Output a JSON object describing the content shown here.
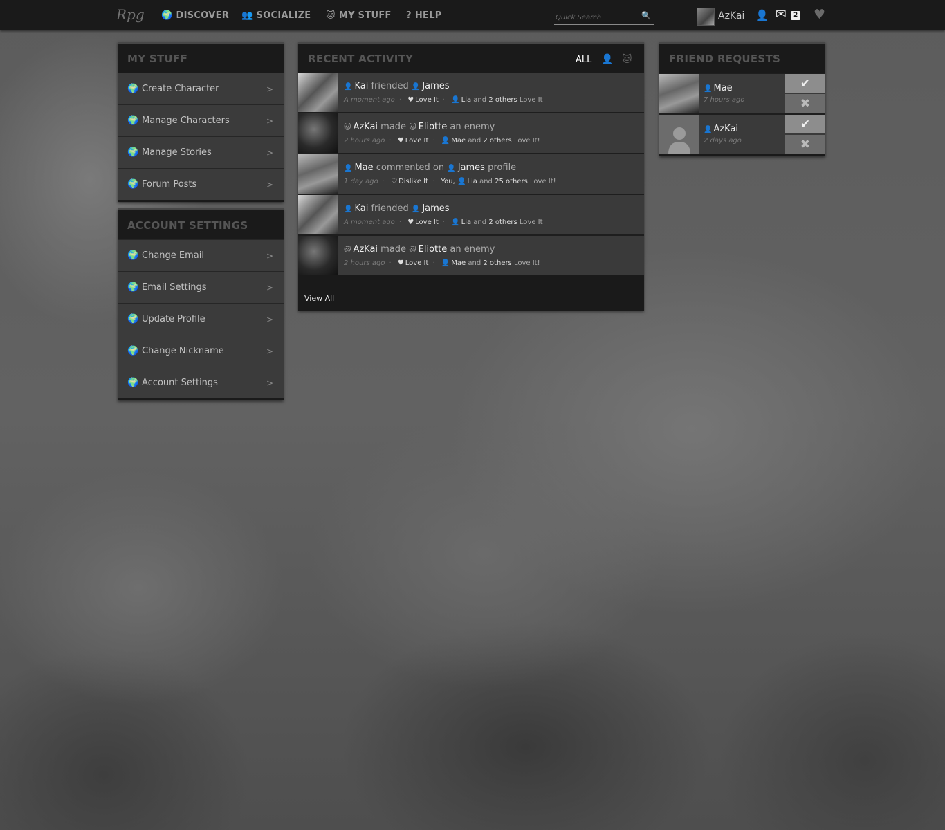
{
  "header": {
    "logo": "Rpg",
    "nav": [
      {
        "label": "DISCOVER",
        "icon": "🌍"
      },
      {
        "label": "SOCIALIZE",
        "icon": "👥"
      },
      {
        "label": "MY STUFF",
        "icon": "🐱"
      },
      {
        "label": "HELP",
        "icon": "?"
      }
    ],
    "search_placeholder": "Quick Search",
    "search_icon": "🔍",
    "username": "AzKai",
    "mail_count": "2",
    "icons": {
      "profile": "👤",
      "mail": "✉",
      "favorites": "♥"
    }
  },
  "my_stuff": {
    "title": "MY STUFF",
    "icon": "🌍",
    "arrow": ">",
    "items": [
      {
        "label": "Create Character"
      },
      {
        "label": "Manage Characters"
      },
      {
        "label": "Manage Stories"
      },
      {
        "label": "Forum Posts"
      }
    ]
  },
  "account_settings": {
    "title": "ACCOUNT SETTINGS",
    "icon": "🌍",
    "arrow": ">",
    "items": [
      {
        "label": "Change Email"
      },
      {
        "label": "Email Settings"
      },
      {
        "label": "Update Profile"
      },
      {
        "label": "Change Nickname"
      },
      {
        "label": "Account Settings"
      }
    ]
  },
  "activity": {
    "title": "RECENT ACTIVITY",
    "filters": {
      "all": "ALL",
      "person_icon": "👤",
      "character_icon": "🐱"
    },
    "view_all": "View All",
    "items": [
      {
        "actor": "Kai",
        "actor_icon": "👤",
        "verb": "friended",
        "target": "James",
        "target_icon": "👤",
        "suffix": "",
        "time": "A moment ago",
        "reaction": "Love It",
        "reaction_icon": "♥",
        "prefix_you": "",
        "liker": "Lia",
        "and_text": "and",
        "others": "2 others",
        "tail": "Love It!"
      },
      {
        "actor": "AzKai",
        "actor_icon": "🐱",
        "verb": "made",
        "target": "Eliotte",
        "target_icon": "🐱",
        "suffix": "an enemy",
        "time": "2 hours ago",
        "reaction": "Love It",
        "reaction_icon": "♥",
        "prefix_you": "",
        "liker": "Mae",
        "and_text": "and",
        "others": "2 others",
        "tail": "Love It!"
      },
      {
        "actor": "Mae",
        "actor_icon": "👤",
        "verb": "commented on",
        "target": "James",
        "target_icon": "👤",
        "suffix": "profile",
        "time": "1 day ago",
        "reaction": "Dislike It",
        "reaction_icon": "♡",
        "prefix_you": "You,",
        "liker": "Lia",
        "and_text": "and",
        "others": "25 others",
        "tail": "Love It!"
      },
      {
        "actor": "Kai",
        "actor_icon": "👤",
        "verb": "friended",
        "target": "James",
        "target_icon": "👤",
        "suffix": "",
        "time": "A moment ago",
        "reaction": "Love It",
        "reaction_icon": "♥",
        "prefix_you": "",
        "liker": "Lia",
        "and_text": "and",
        "others": "2 others",
        "tail": "Love It!"
      },
      {
        "actor": "AzKai",
        "actor_icon": "🐱",
        "verb": "made",
        "target": "Eliotte",
        "target_icon": "🐱",
        "suffix": "an enemy",
        "time": "2 hours ago",
        "reaction": "Love It",
        "reaction_icon": "♥",
        "prefix_you": "",
        "liker": "Mae",
        "and_text": "and",
        "others": "2 others",
        "tail": "Love It!"
      }
    ]
  },
  "friend_requests": {
    "title": "FRIEND REQUESTS",
    "accept_icon": "✔",
    "reject_icon": "✖",
    "items": [
      {
        "name": "Mae",
        "name_icon": "👤",
        "time": "7 hours ago"
      },
      {
        "name": "AzKai",
        "name_icon": "👤",
        "time": "2 days ago"
      }
    ]
  }
}
